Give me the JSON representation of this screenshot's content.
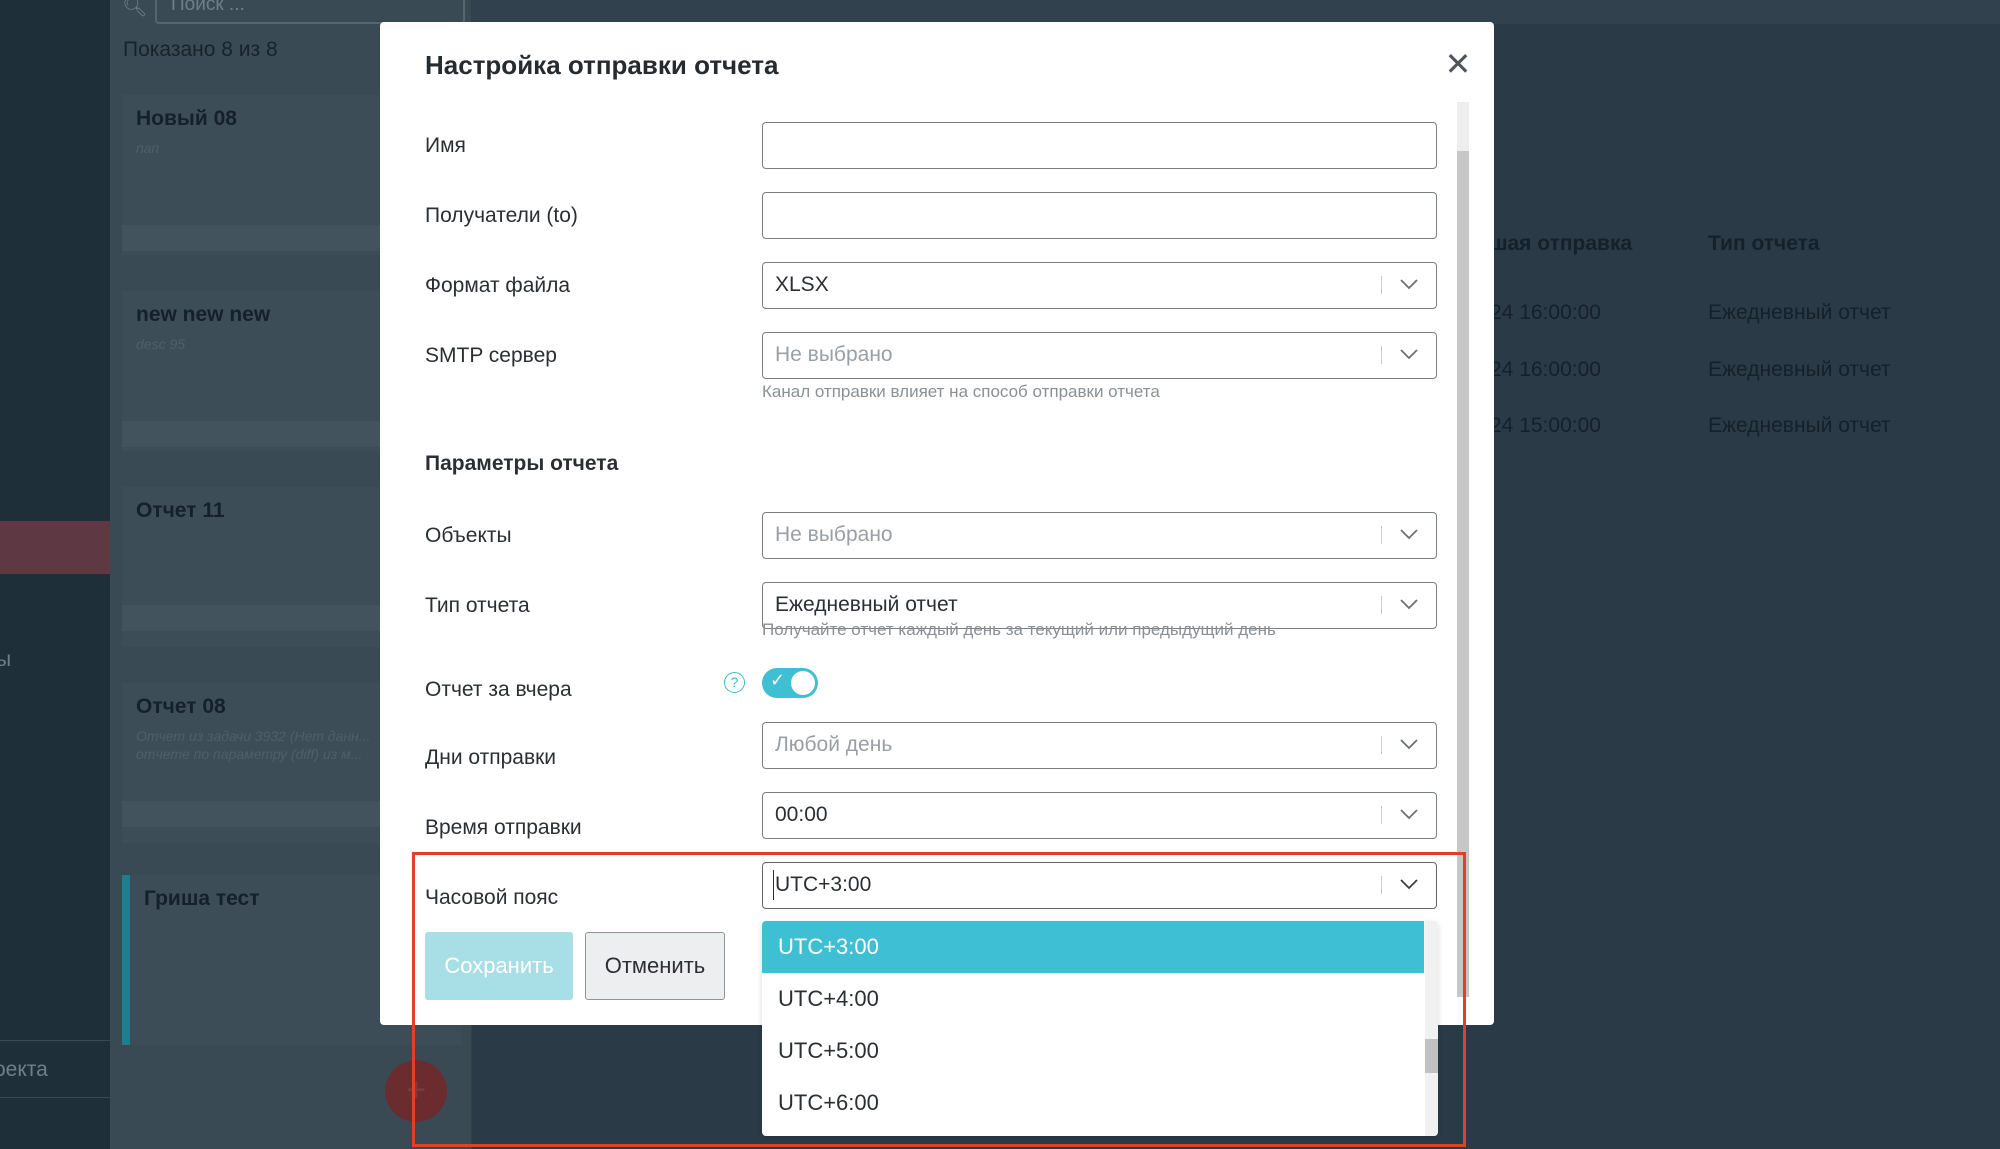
{
  "sidebar": {
    "partial_text_1": "ы",
    "partial_text_2": "оекта"
  },
  "list": {
    "search_placeholder": "Поиск ...",
    "shown_label": "Показано",
    "shown_count": "8 из 8",
    "cards": [
      {
        "title": "Новый 08",
        "desc": "пап"
      },
      {
        "title": "new new new",
        "desc": "desc 95"
      },
      {
        "title": "Отчет 11",
        "desc": ""
      },
      {
        "title": "Отчет 08",
        "desc": "Отчет из задачи 3932 (Нет данн... отчете по параметру (diff) из м..."
      },
      {
        "title": "Гриша тест",
        "desc": ""
      }
    ],
    "fab_label": "+"
  },
  "table": {
    "headers": [
      "шая отправка",
      "Тип отчета"
    ],
    "rows": [
      [
        "24 16:00:00",
        "Ежедневный отчет"
      ],
      [
        "24 16:00:00",
        "Ежедневный отчет"
      ],
      [
        "24 15:00:00",
        "Ежедневный отчет"
      ]
    ]
  },
  "modal": {
    "title": "Настройка отправки отчета",
    "close_icon": "close-icon",
    "fields": {
      "name": {
        "label": "Имя",
        "value": ""
      },
      "recipients": {
        "label": "Получатели (to)",
        "value": ""
      },
      "file_format": {
        "label": "Формат файла",
        "value": "XLSX"
      },
      "smtp": {
        "label": "SMTP сервер",
        "placeholder": "Не выбрано",
        "hint": "Канал отправки влияет на способ отправки отчета"
      },
      "section_params": "Параметры отчета",
      "objects": {
        "label": "Объекты",
        "placeholder": "Не выбрано"
      },
      "report_type": {
        "label": "Тип отчета",
        "value": "Ежедневный отчет",
        "hint": "Получайте отчет каждый день за текущий или предыдущий день"
      },
      "yesterday": {
        "label": "Отчет за вчера",
        "help": "?",
        "enabled": true
      },
      "send_days": {
        "label": "Дни отправки",
        "placeholder": "Любой день"
      },
      "send_time": {
        "label": "Время отправки",
        "value": "00:00"
      },
      "timezone": {
        "label": "Часовой пояс",
        "value": "UTC+3:00"
      }
    },
    "buttons": {
      "save": "Сохранить",
      "cancel": "Отменить"
    },
    "timezone_options": [
      "UTC+3:00",
      "UTC+4:00",
      "UTC+5:00",
      "UTC+6:00"
    ],
    "timezone_selected_index": 0
  },
  "colors": {
    "accent": "#3fbfd3",
    "highlight": "#e0402a",
    "overlay": "#2a3b47"
  }
}
